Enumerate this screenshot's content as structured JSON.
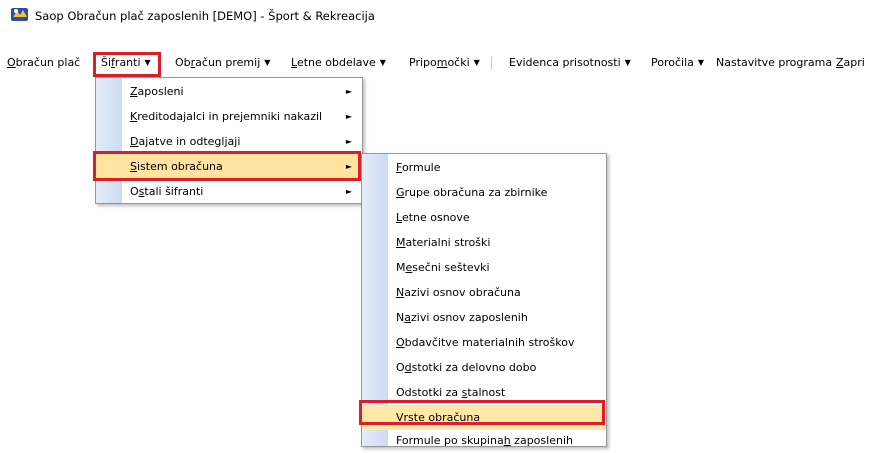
{
  "window": {
    "title": "Saop Obračun plač zaposlenih  [DEMO] - Šport & Rekreacija"
  },
  "menubar": {
    "items": [
      {
        "pre": "",
        "ul": "O",
        "post": "bračun plač",
        "arrow": false
      },
      {
        "pre": "Ši",
        "ul": "f",
        "post": "ranti",
        "arrow": true
      },
      {
        "pre": "Ob",
        "ul": "r",
        "post": "ačun premij",
        "arrow": true
      },
      {
        "pre": "",
        "ul": "L",
        "post": "etne obdelave",
        "arrow": true
      },
      {
        "pre": "Pripo",
        "ul": "m",
        "post": "očki",
        "arrow": true
      },
      {
        "pre": "Evidenca prisotnosti",
        "ul": "",
        "post": "",
        "arrow": true
      },
      {
        "pre": "Poročila",
        "ul": "",
        "post": "",
        "arrow": true
      },
      {
        "pre": "Nastavitve programa",
        "ul": "",
        "post": "",
        "arrow": false
      },
      {
        "pre": "",
        "ul": "Z",
        "post": "apri",
        "arrow": false
      }
    ],
    "arrow_glyph": "▼"
  },
  "sifranti_menu": {
    "items": [
      {
        "pre": "",
        "ul": "Z",
        "post": "aposleni",
        "submenu": true
      },
      {
        "pre": "",
        "ul": "K",
        "post": "reditodajalci in prejemniki nakazil",
        "submenu": true
      },
      {
        "pre": "",
        "ul": "D",
        "post": "ajatve in odtegljaji",
        "submenu": true
      },
      {
        "pre": "",
        "ul": "S",
        "post": "istem obračuna",
        "submenu": true
      },
      {
        "pre": "O",
        "ul": "s",
        "post": "tali šifranti",
        "submenu": true
      }
    ],
    "submenu_glyph": "►"
  },
  "sistem_obracuna_menu": {
    "items": [
      {
        "pre": "",
        "ul": "F",
        "post": "ormule"
      },
      {
        "pre": "",
        "ul": "G",
        "post": "rupe obračuna za zbirnike"
      },
      {
        "pre": "",
        "ul": "L",
        "post": "etne osnove"
      },
      {
        "pre": "",
        "ul": "M",
        "post": "aterialni stroški"
      },
      {
        "pre": "M",
        "ul": "e",
        "post": "sečni seštevki"
      },
      {
        "pre": "",
        "ul": "N",
        "post": "azivi osnov obračuna"
      },
      {
        "pre": "N",
        "ul": "a",
        "post": "zivi osnov zaposlenih"
      },
      {
        "pre": "",
        "ul": "O",
        "post": "bdavčitve materialnih stroškov"
      },
      {
        "pre": "O",
        "ul": "d",
        "post": "stotki za delovno dobo"
      },
      {
        "pre": "Odstotki za ",
        "ul": "s",
        "post": "talnost"
      },
      {
        "pre": "",
        "ul": "V",
        "post": "rste obračuna"
      },
      {
        "pre": "Formule po skupina",
        "ul": "h",
        "post": " zaposlenih"
      }
    ]
  },
  "colors": {
    "highlight_border": "#d9202a",
    "active_item": "#fee3a1",
    "menu_gutter": "#d6e2f5"
  }
}
